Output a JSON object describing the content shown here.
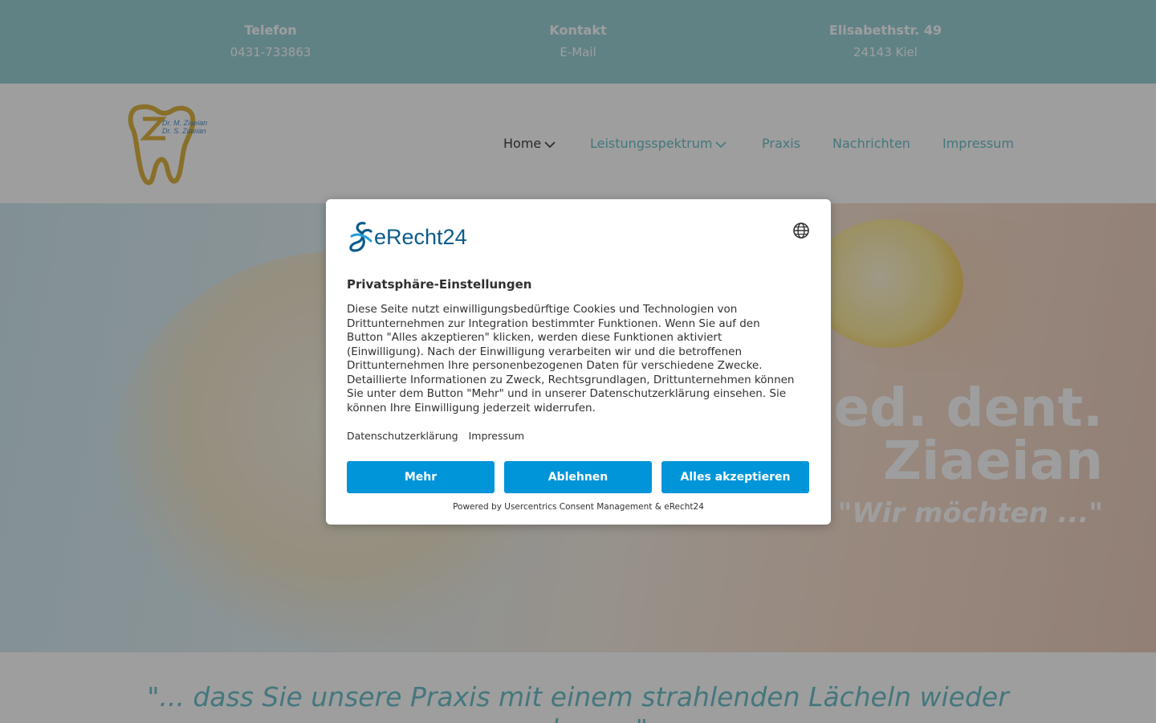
{
  "topbar": {
    "items": [
      {
        "heading": "Telefon",
        "value": "0431-733863"
      },
      {
        "heading": "Kontakt",
        "value": "E-Mail"
      },
      {
        "heading": "Elisabethstr. 49",
        "value": "24143 Kiel"
      }
    ]
  },
  "logo": {
    "line1": "Dr. M. Ziaeian",
    "line2": "Dr. S. Ziaeian"
  },
  "nav": {
    "items": [
      {
        "label": "Home"
      },
      {
        "label": "Leistungsspektrum"
      },
      {
        "label": "Praxis"
      },
      {
        "label": "Nachrichten"
      },
      {
        "label": "Impressum"
      }
    ]
  },
  "hero": {
    "title_line1": "med. dent.",
    "title_line2": "Ziaeian",
    "quote": "\"Wir möchten ...\""
  },
  "slogan": {
    "text": "\"... dass Sie unsere Praxis mit einem strahlenden Lächeln wieder verlassen\""
  },
  "consent": {
    "brand": "eRecht24",
    "title": "Privatsphäre-Einstellungen",
    "body": "Diese Seite nutzt einwilligungsbedürftige Cookies und Technologien von Drittunternehmen zur Integration bestimmter Funktionen. Wenn Sie auf den Button \"Alles akzeptieren\" klicken, werden diese Funktionen aktiviert (Einwilligung). Nach der Einwilligung verarbeiten wir und die betroffenen Drittunternehmen Ihre personenbezogenen Daten für verschiedene Zwecke. Detaillierte Informationen zu Zweck, Rechtsgrundlagen, Drittunternehmen können Sie unter dem Button \"Mehr\" und in unserer Datenschutzerklärung einsehen. Sie können Ihre Einwilligung jederzeit widerrufen.",
    "link_privacy": "Datenschutzerklärung",
    "link_imprint": "Impressum",
    "btn_more": "Mehr",
    "btn_deny": "Ablehnen",
    "btn_accept": "Alles akzeptieren",
    "powered": "Powered by Usercentrics Consent Management & eRecht24"
  },
  "colors": {
    "topbar": "#8ecdd1",
    "accent": "#5bb8c4",
    "button": "#0095d9",
    "logo_gold": "#d9a92a",
    "brand_blue": "#0b5b8a"
  }
}
